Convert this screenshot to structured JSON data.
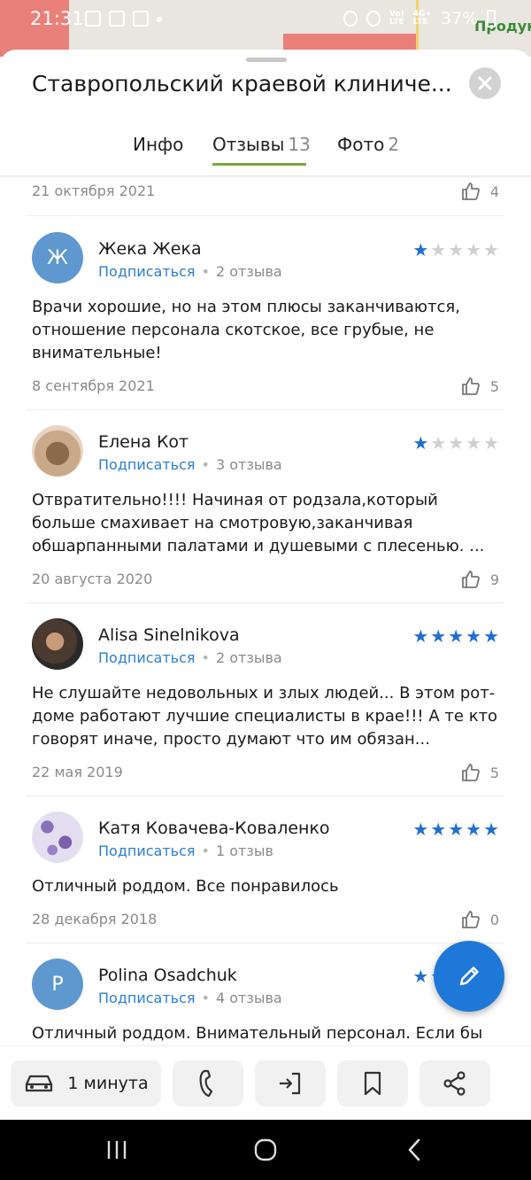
{
  "status_bar": {
    "time": "21:31",
    "battery": "37%",
    "signal_top": "Vo)",
    "signal_bottom": "LTE",
    "net_top": "4G+",
    "net_bottom": "LTE"
  },
  "map": {
    "label": "Продукт"
  },
  "header": {
    "title": "Ставропольский краевой клиниче...",
    "close_icon": "close-icon"
  },
  "tabs": [
    {
      "label": "Инфо",
      "count": ""
    },
    {
      "label": "Отзывы",
      "count": "13",
      "active": true
    },
    {
      "label": "Фото",
      "count": "2"
    }
  ],
  "top_item": {
    "date": "21 октября 2021",
    "likes": "4"
  },
  "reviews": [
    {
      "avatar_letter": "Ж",
      "name": "Жека Жека",
      "subscribe": "Подписаться",
      "review_count": "2 отзыва",
      "rating": 1,
      "text": "Врачи хорошие, но на этом плюсы заканчиваются, отношение персонала скотское, все грубые, не внимательные!",
      "date": "8 сентября 2021",
      "likes": "5"
    },
    {
      "avatar_letter": "",
      "name": "Елена Кот",
      "subscribe": "Подписаться",
      "review_count": "3 отзыва",
      "rating": 1,
      "text": "Отвратительно!!!! Начиная от родзала,который больше смахивает на смотровую,заканчивая обшарпанными палатами и душевыми с плесенью. ...",
      "date": "20 августа 2020",
      "likes": "9"
    },
    {
      "avatar_letter": "",
      "name": "Alisa Sinelnikova",
      "subscribe": "Подписаться",
      "review_count": "2 отзыва",
      "rating": 5,
      "text": "Не слушайте недовольных и злых людей... В этом рот-доме работают лучшие специалисты в крае!!! А те кто говорят иначе, просто думают что им обязан...",
      "date": "22 мая 2019",
      "likes": "5"
    },
    {
      "avatar_letter": "",
      "name": "Катя Ковачева-Коваленко",
      "subscribe": "Подписаться",
      "review_count": "1 отзыв",
      "rating": 5,
      "text": "Отличный роддом. Все понравилось",
      "date": "28 декабря 2018",
      "likes": "0"
    },
    {
      "avatar_letter": "P",
      "name": "Polina Osadchuk",
      "subscribe": "Подписаться",
      "review_count": "4 отзыва",
      "rating": 5,
      "text": "Отличный роддом. Внимательный персонал. Если бы",
      "date": "",
      "likes": ""
    }
  ],
  "fab": {
    "icon": "pencil-icon"
  },
  "actions": {
    "route_label": "1 минута",
    "icons": [
      "car-icon",
      "phone-icon",
      "enter-icon",
      "bookmark-icon",
      "share-icon"
    ]
  },
  "nav": {
    "icons": [
      "recents-icon",
      "home-icon",
      "back-icon"
    ]
  },
  "colors": {
    "accent": "#1e78d7",
    "link": "#2b7fd1",
    "tab_underline": "#7aa83a",
    "star_on": "#1f6fd1",
    "star_off": "#cfcfcf"
  }
}
